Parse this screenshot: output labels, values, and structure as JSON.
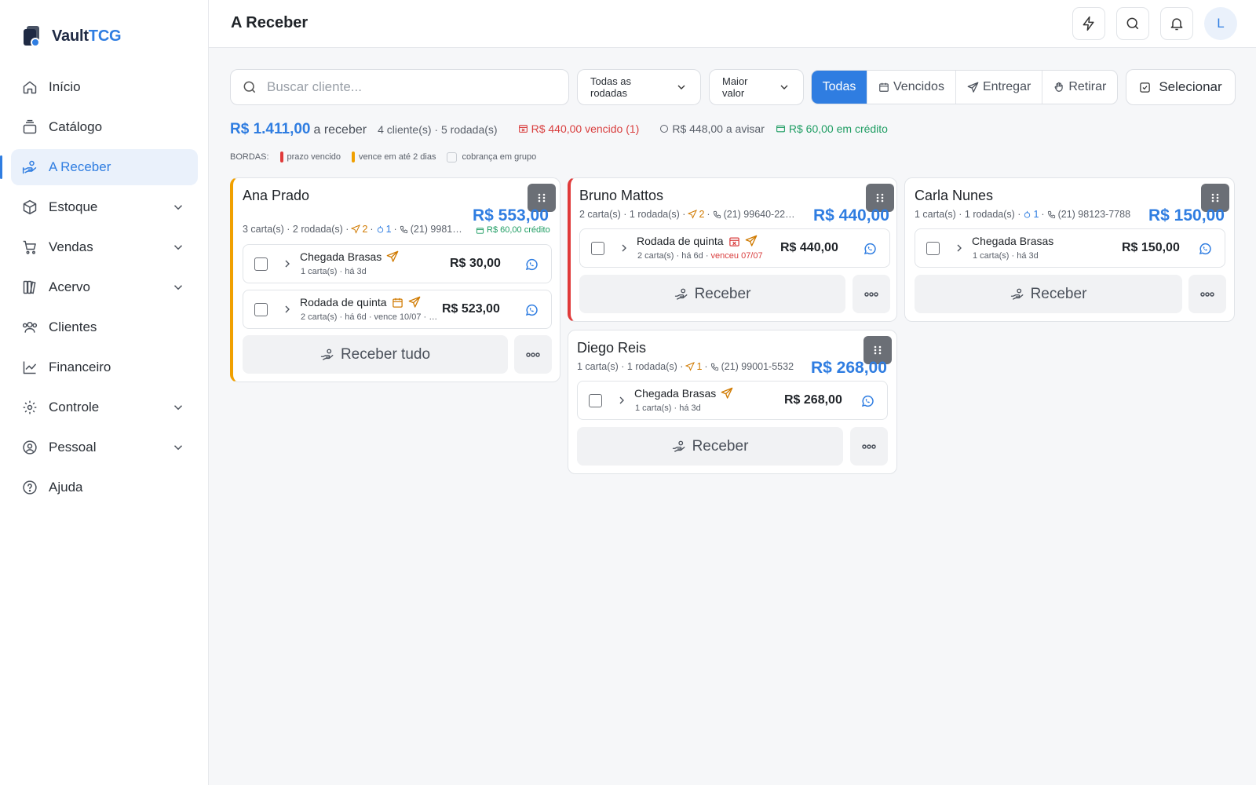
{
  "brand": {
    "name_part1": "Vault",
    "name_part2": "TCG"
  },
  "sidebar": {
    "items": [
      {
        "label": "Início",
        "icon": "home-icon"
      },
      {
        "label": "Catálogo",
        "icon": "catalog-icon"
      },
      {
        "label": "A Receber",
        "icon": "hand-coin-icon",
        "active": true
      },
      {
        "label": "Estoque",
        "icon": "box-icon",
        "expandable": true
      },
      {
        "label": "Vendas",
        "icon": "cart-icon",
        "expandable": true
      },
      {
        "label": "Acervo",
        "icon": "library-icon",
        "expandable": true
      },
      {
        "label": "Clientes",
        "icon": "users-icon"
      },
      {
        "label": "Financeiro",
        "icon": "chart-line-icon"
      },
      {
        "label": "Controle",
        "icon": "gear-icon",
        "expandable": true
      },
      {
        "label": "Pessoal",
        "icon": "user-circle-icon",
        "expandable": true
      },
      {
        "label": "Ajuda",
        "icon": "help-icon"
      }
    ]
  },
  "header": {
    "title": "A Receber",
    "avatar_initial": "L"
  },
  "toolbar": {
    "search_placeholder": "Buscar cliente...",
    "rounds_filter": "Todas as rodadas",
    "sort": "Maior valor",
    "segments": [
      "Todas",
      "Vencidos",
      "Entregar",
      "Retirar"
    ],
    "select_label": "Selecionar"
  },
  "summary": {
    "total": "R$ 1.411,00",
    "total_label": "a receber",
    "counts": "4 cliente(s) · 5 rodada(s)",
    "overdue": "R$ 440,00 vencido (1)",
    "to_notify": "R$ 448,00 a avisar",
    "credit": "R$ 60,00 em crédito"
  },
  "legend": {
    "title": "BORDAS:",
    "overdue": "prazo vencido",
    "soon": "vence em até 2 dias",
    "group": "cobrança em grupo"
  },
  "colors": {
    "accent": "#2f7de1",
    "overdue": "#e03a3a",
    "soon": "#f0a000",
    "credit": "#1f9d63"
  },
  "cards": [
    {
      "name": "Ana Prado",
      "total": "R$ 553,00",
      "meta_counts": "3 carta(s) · 2 rodada(s) ·",
      "deliver": "2",
      "pickup": "1",
      "phone": "(21) 9981…",
      "credit": "R$ 60,00 crédito",
      "rounds": [
        {
          "name": "Chegada Brasas",
          "sub": "1 carta(s) · há 3d",
          "amount": "R$ 30,00"
        },
        {
          "name": "Rodada de quinta",
          "sub": "2 carta(s) · há 6d · vence 10/07 · …",
          "amount": "R$ 523,00"
        }
      ],
      "action": "Receber tudo"
    },
    {
      "name": "Bruno Mattos",
      "total": "R$ 440,00",
      "meta_counts": "2 carta(s) · 1 rodada(s) ·",
      "deliver": "2",
      "phone": "(21) 99640-22…",
      "rounds": [
        {
          "name": "Rodada de quinta",
          "sub": "2 carta(s) · há 6d ·",
          "late": "venceu 07/07",
          "amount": "R$ 440,00"
        }
      ],
      "action": "Receber"
    },
    {
      "name": "Carla Nunes",
      "total": "R$ 150,00",
      "meta_counts": "1 carta(s) · 1 rodada(s) ·",
      "pickup": "1",
      "phone": "(21) 98123-7788",
      "rounds": [
        {
          "name": "Chegada Brasas",
          "sub": "1 carta(s) · há 3d",
          "amount": "R$ 150,00"
        }
      ],
      "action": "Receber"
    },
    {
      "name": "Diego Reis",
      "total": "R$ 268,00",
      "meta_counts": "1 carta(s) · 1 rodada(s) ·",
      "deliver": "1",
      "phone": "(21) 99001-5532",
      "rounds": [
        {
          "name": "Chegada Brasas",
          "sub": "1 carta(s) · há 3d",
          "amount": "R$ 268,00"
        }
      ],
      "action": "Receber"
    }
  ]
}
